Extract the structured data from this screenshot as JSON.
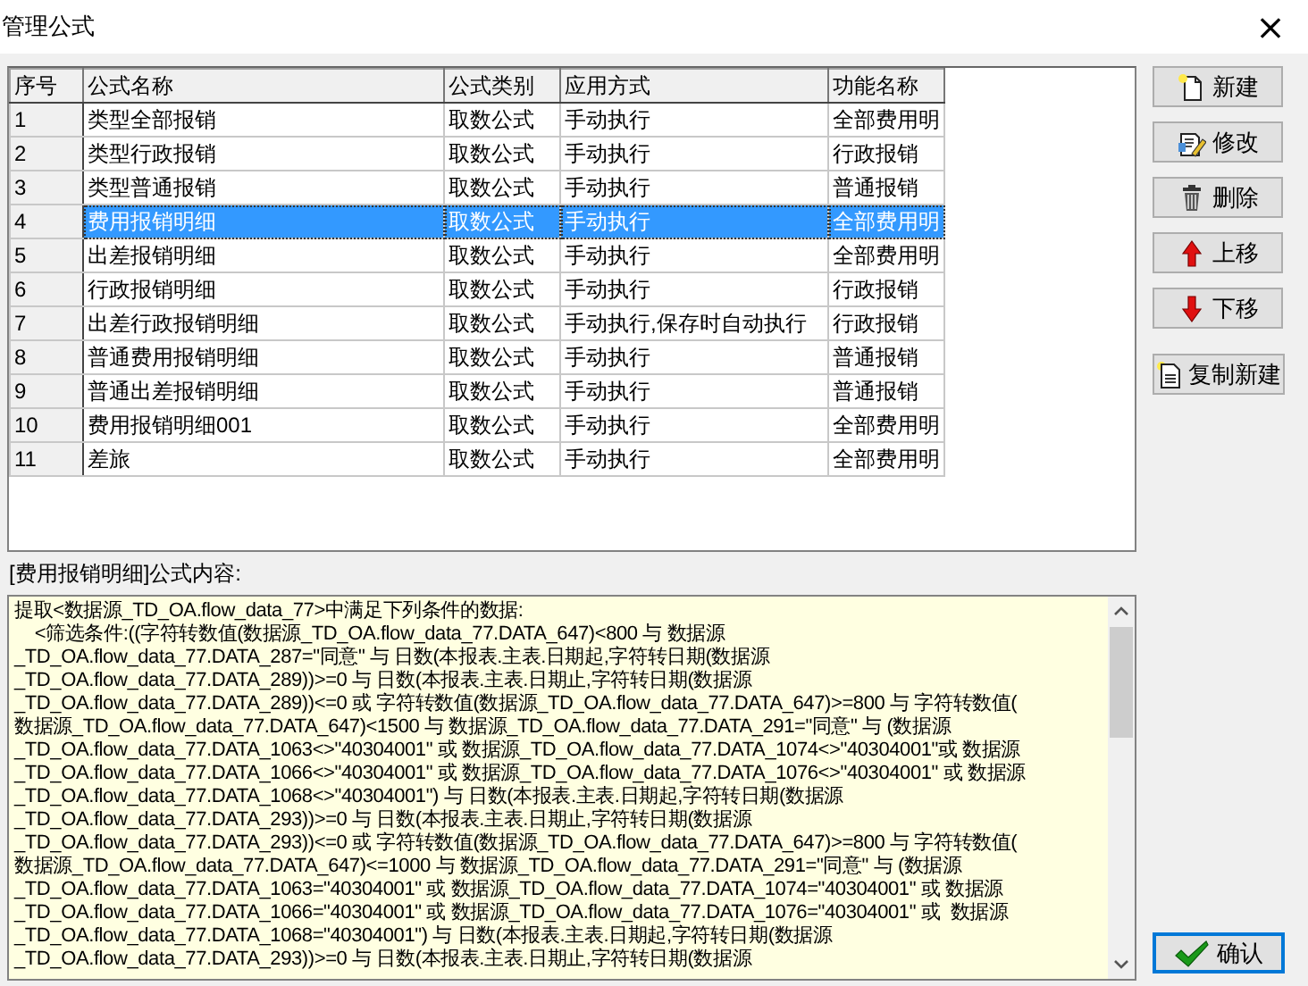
{
  "window": {
    "title": "管理公式",
    "close": "×"
  },
  "table": {
    "columns": [
      "序号",
      "公式名称",
      "公式类别",
      "应用方式",
      "功能名称"
    ],
    "rows": [
      {
        "cells": [
          "1",
          "类型全部报销",
          "取数公式",
          "手动执行",
          "全部费用明"
        ],
        "selected": false
      },
      {
        "cells": [
          "2",
          "类型行政报销",
          "取数公式",
          "手动执行",
          "行政报销"
        ],
        "selected": false
      },
      {
        "cells": [
          "3",
          "类型普通报销",
          "取数公式",
          "手动执行",
          "普通报销"
        ],
        "selected": false
      },
      {
        "cells": [
          "4",
          "费用报销明细",
          "取数公式",
          "手动执行",
          "全部费用明"
        ],
        "selected": true
      },
      {
        "cells": [
          "5",
          "出差报销明细",
          "取数公式",
          "手动执行",
          "全部费用明"
        ],
        "selected": false
      },
      {
        "cells": [
          "6",
          "行政报销明细",
          "取数公式",
          "手动执行",
          "行政报销"
        ],
        "selected": false
      },
      {
        "cells": [
          "7",
          "出差行政报销明细",
          "取数公式",
          "手动执行,保存时自动执行",
          "行政报销"
        ],
        "selected": false
      },
      {
        "cells": [
          "8",
          "普通费用报销明细",
          "取数公式",
          "手动执行",
          "普通报销"
        ],
        "selected": false
      },
      {
        "cells": [
          "9",
          "普通出差报销明细",
          "取数公式",
          "手动执行",
          "普通报销"
        ],
        "selected": false
      },
      {
        "cells": [
          "10",
          "费用报销明细001",
          "取数公式",
          "手动执行",
          "全部费用明"
        ],
        "selected": false
      },
      {
        "cells": [
          "11",
          "差旅",
          "取数公式",
          "手动执行",
          "全部费用明"
        ],
        "selected": false
      }
    ]
  },
  "buttons": [
    {
      "label": "新建"
    },
    {
      "label": "修改"
    },
    {
      "label": "删除"
    },
    {
      "label": "上移"
    },
    {
      "label": "下移"
    },
    {
      "label": "复制新建"
    }
  ],
  "formula": {
    "label": "[费用报销明细]公式内容:",
    "lines": [
      "提取<数据源_TD_OA.flow_data_77>中满足下列条件的数据:",
      "    <筛选条件:((字符转数值(数据源_TD_OA.flow_data_77.DATA_647)<800 与 数据源",
      "_TD_OA.flow_data_77.DATA_287=\"同意\" 与 日数(本报表.主表.日期起,字符转日期(数据源",
      "_TD_OA.flow_data_77.DATA_289))>=0 与 日数(本报表.主表.日期止,字符转日期(数据源",
      "_TD_OA.flow_data_77.DATA_289))<=0 或 字符转数值(数据源_TD_OA.flow_data_77.DATA_647)>=800 与 字符转数值(",
      "数据源_TD_OA.flow_data_77.DATA_647)<1500 与 数据源_TD_OA.flow_data_77.DATA_291=\"同意\" 与 (数据源",
      "_TD_OA.flow_data_77.DATA_1063<>\"40304001\" 或 数据源_TD_OA.flow_data_77.DATA_1074<>\"40304001\"或 数据源",
      "_TD_OA.flow_data_77.DATA_1066<>\"40304001\" 或 数据源_TD_OA.flow_data_77.DATA_1076<>\"40304001\" 或 数据源",
      "_TD_OA.flow_data_77.DATA_1068<>\"40304001\") 与 日数(本报表.主表.日期起,字符转日期(数据源",
      "_TD_OA.flow_data_77.DATA_293))>=0 与 日数(本报表.主表.日期止,字符转日期(数据源",
      "_TD_OA.flow_data_77.DATA_293))<=0 或 字符转数值(数据源_TD_OA.flow_data_77.DATA_647)>=800 与 字符转数值(",
      "数据源_TD_OA.flow_data_77.DATA_647)<=1000 与 数据源_TD_OA.flow_data_77.DATA_291=\"同意\" 与 (数据源",
      "_TD_OA.flow_data_77.DATA_1063=\"40304001\" 或 数据源_TD_OA.flow_data_77.DATA_1074=\"40304001\" 或 数据源",
      "_TD_OA.flow_data_77.DATA_1066=\"40304001\" 或 数据源_TD_OA.flow_data_77.DATA_1076=\"40304001\" 或  数据源",
      "_TD_OA.flow_data_77.DATA_1068=\"40304001\") 与 日数(本报表.主表.日期起,字符转日期(数据源",
      "_TD_OA.flow_data_77.DATA_293))>=0 与 日数(本报表.主表.日期止,字符转日期(数据源"
    ]
  },
  "confirm": {
    "label": "确认"
  }
}
